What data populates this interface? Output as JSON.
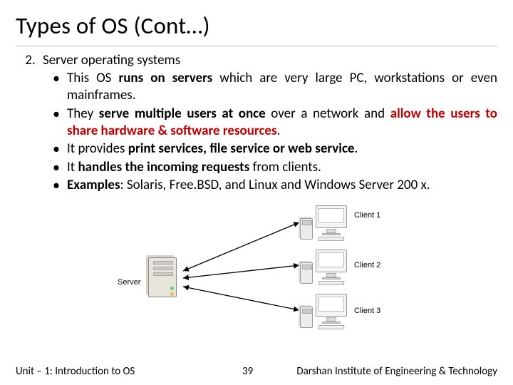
{
  "title": "Types of OS (Cont…)",
  "list": {
    "start": 2,
    "heading": "Server operating systems",
    "bullets": [
      {
        "segments": [
          {
            "t": "This OS ",
            "c": ""
          },
          {
            "t": "runs on servers",
            "c": "b"
          },
          {
            "t": " which are very large PC, workstations or even mainframes.",
            "c": ""
          }
        ]
      },
      {
        "segments": [
          {
            "t": "They ",
            "c": ""
          },
          {
            "t": "serve multiple users at once",
            "c": "b"
          },
          {
            "t": " over a network and ",
            "c": ""
          },
          {
            "t": "allow the users to share hardware & software resources",
            "c": "r"
          },
          {
            "t": ".",
            "c": ""
          }
        ]
      },
      {
        "segments": [
          {
            "t": "It provides ",
            "c": ""
          },
          {
            "t": "print services, file service or web service",
            "c": "b"
          },
          {
            "t": ".",
            "c": ""
          }
        ]
      },
      {
        "segments": [
          {
            "t": "It ",
            "c": ""
          },
          {
            "t": "handles the incoming requests",
            "c": "b"
          },
          {
            "t": " from clients.",
            "c": ""
          }
        ]
      },
      {
        "segments": [
          {
            "t": "Examples",
            "c": "b"
          },
          {
            "t": ": Solaris, Free.BSD, and Linux and Windows Server 200 x.",
            "c": ""
          }
        ]
      }
    ]
  },
  "diagram": {
    "server_label": "Server",
    "clients": [
      "Client 1",
      "Client 2",
      "Client 3"
    ]
  },
  "footer": {
    "left": "Unit – 1: Introduction to OS",
    "page": "39",
    "right": "Darshan Institute of Engineering & Technology"
  }
}
